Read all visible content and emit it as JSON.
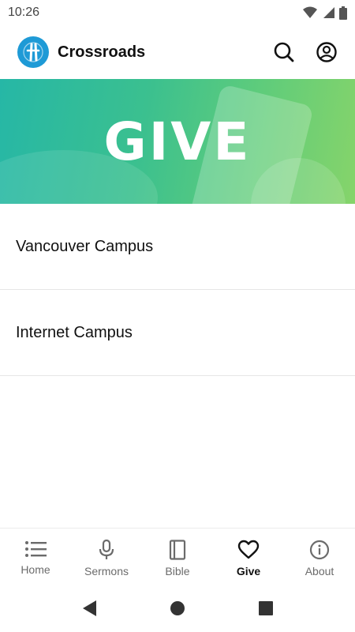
{
  "status_bar": {
    "time": "10:26",
    "icons": [
      "wifi-icon",
      "signal-icon",
      "battery-icon"
    ]
  },
  "app_bar": {
    "title": "Crossroads",
    "logo": "crossroads-logo",
    "actions": [
      "search-icon",
      "account-icon"
    ]
  },
  "banner": {
    "title": "GIVE"
  },
  "campuses": [
    {
      "label": "Vancouver Campus"
    },
    {
      "label": "Internet Campus"
    }
  ],
  "bottom_nav": {
    "items": [
      {
        "label": "Home",
        "icon": "list-icon",
        "active": false
      },
      {
        "label": "Sermons",
        "icon": "microphone-icon",
        "active": false
      },
      {
        "label": "Bible",
        "icon": "book-icon",
        "active": false
      },
      {
        "label": "Give",
        "icon": "heart-icon",
        "active": true
      },
      {
        "label": "About",
        "icon": "info-icon",
        "active": false
      }
    ]
  },
  "system_nav": [
    "back-icon",
    "home-icon",
    "recents-icon"
  ],
  "colors": {
    "logo_blue": "#1e9ad6",
    "banner_start": "#26b7a6",
    "banner_end": "#86d46a"
  }
}
